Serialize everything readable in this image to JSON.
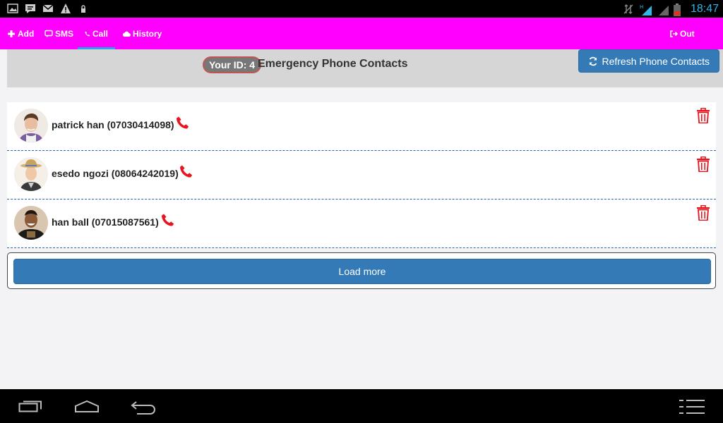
{
  "status_bar": {
    "time": "18:47",
    "left_icons": [
      "image-icon",
      "chat-icon",
      "mail-icon",
      "warning-icon",
      "lock-icon"
    ],
    "right_icons": [
      "no-data-icon",
      "signal-h-icon",
      "signal-icon",
      "battery-icon"
    ]
  },
  "nav": {
    "items": [
      {
        "label": "Add",
        "icon": "plus-icon"
      },
      {
        "label": "SMS",
        "icon": "message-icon"
      },
      {
        "label": "Call",
        "icon": "phone-icon"
      },
      {
        "label": "History",
        "icon": "cloud-icon"
      }
    ],
    "active_index": 2,
    "logout": {
      "label": "Out",
      "icon": "logout-icon"
    },
    "background_color": "#ff00ff",
    "active_underline_color": "#2fa3e8"
  },
  "header": {
    "id_badge": "Your ID: 4",
    "title": "Emergency Phone Contacts",
    "refresh_button": "Refresh Phone Contacts"
  },
  "contacts": [
    {
      "text": "patrick han (07030414098)",
      "call_icon": "phone-icon",
      "delete_icon": "trash-icon"
    },
    {
      "text": "esedo ngozi (08064242019)",
      "call_icon": "phone-icon",
      "delete_icon": "trash-icon"
    },
    {
      "text": "han ball (07015087561)",
      "call_icon": "phone-icon",
      "delete_icon": "trash-icon"
    }
  ],
  "load_more": "Load more",
  "colors": {
    "accent_blue": "#337ab7",
    "danger_red": "#e8141e"
  },
  "system_nav": {
    "icons": [
      "recent-apps-icon",
      "home-icon",
      "back-icon",
      "menu-icon"
    ]
  }
}
